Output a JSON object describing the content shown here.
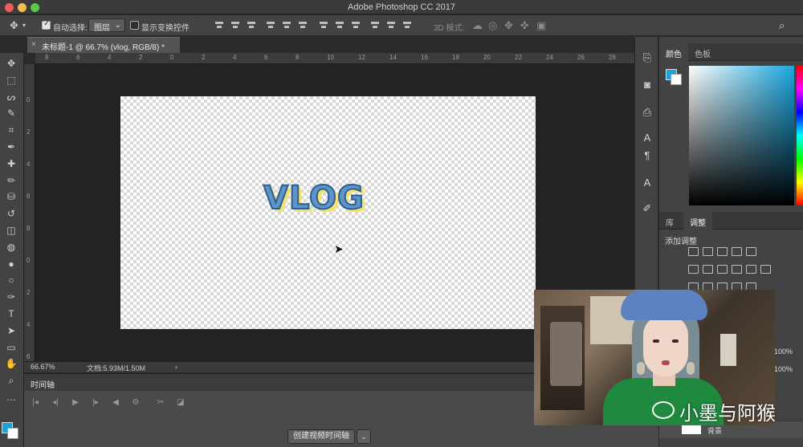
{
  "window": {
    "title": "Adobe Photoshop CC 2017"
  },
  "options_bar": {
    "auto_select_label": "自动选择:",
    "auto_select_checked": true,
    "auto_select_target": "图层",
    "show_transform_label": "显示变换控件",
    "mode_3d_label": "3D 模式:"
  },
  "document": {
    "tab_title": "未标题-1 @ 66.7% (vlog, RGB/8) *",
    "close_glyph": "×",
    "canvas_text": "VLOG",
    "ruler_h_ticks": [
      "8",
      "6",
      "4",
      "2",
      "0",
      "2",
      "4",
      "6",
      "8",
      "10",
      "12",
      "14",
      "16",
      "18",
      "20",
      "22",
      "24",
      "26",
      "28"
    ],
    "ruler_v_ticks": [
      "0",
      "2",
      "4",
      "6",
      "8",
      "0",
      "2",
      "4",
      "6"
    ]
  },
  "status_bar": {
    "zoom": "66.67%",
    "doc_size": "文档:5.93M/1.50M",
    "arrow": "›"
  },
  "timeline": {
    "title": "时间轴",
    "create_button": "创建视频时间轴",
    "create_arrow": "⌄",
    "controls": [
      "|◂",
      "◂|",
      "▶",
      "|▸",
      "◀",
      "⚙",
      "✂",
      "◪"
    ]
  },
  "toolbox": {
    "tools": [
      "move-tool",
      "marquee-tool",
      "lasso-tool",
      "quick-select-tool",
      "crop-tool",
      "eyedropper-tool",
      "healing-tool",
      "brush-tool",
      "stamp-tool",
      "history-brush-tool",
      "eraser-tool",
      "paint-bucket-tool",
      "blur-tool",
      "dodge-tool",
      "pen-tool",
      "type-tool",
      "path-select-tool",
      "rectangle-tool",
      "hand-tool",
      "zoom-tool",
      "more-tool"
    ],
    "glyphs": [
      "✥",
      "⬚",
      "ᔕ",
      "✎",
      "⌗",
      "✒",
      "✚",
      "✏",
      "⛁",
      "↺",
      "◫",
      "◍",
      "●",
      "○",
      "✑",
      "T",
      "➤",
      "▭",
      "✋",
      "⌕",
      "…"
    ],
    "foreground_color": "#1aa3d7",
    "background_color": "#ffffff"
  },
  "panels": {
    "color_tabs": [
      "颜色",
      "色板"
    ],
    "library_tabs": [
      "库",
      "调整"
    ],
    "adjustments_title": "添加调整",
    "opacity_1": "100%",
    "opacity_2": "100%",
    "layer_name": "背景"
  },
  "watermark": {
    "text": "小墨与阿猴"
  },
  "colors": {
    "accent": "#1aa3d7",
    "vlog_fill": "#5b95c9",
    "vlog_shadow": "#f2e46a"
  }
}
